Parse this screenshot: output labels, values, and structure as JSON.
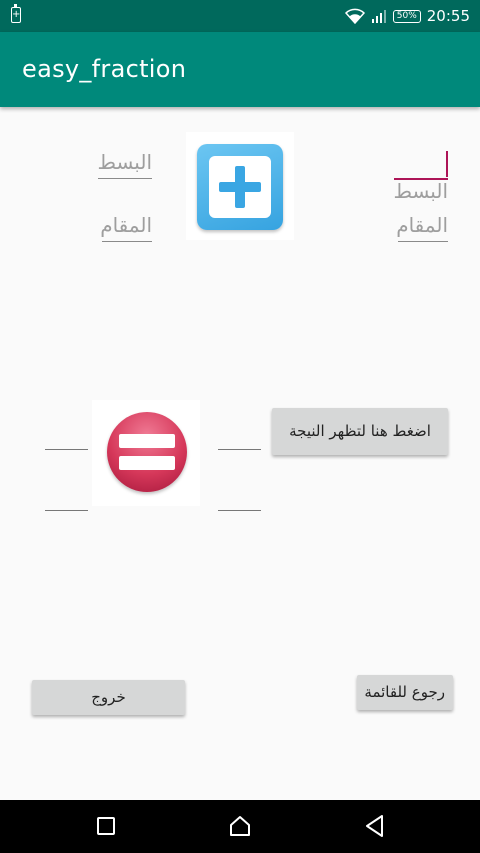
{
  "status_bar": {
    "battery_percent": "50%",
    "time": "20:55"
  },
  "app_bar": {
    "title": "easy_fraction"
  },
  "first_fraction": {
    "numerator_placeholder": "البسط",
    "denominator_placeholder": "المقام"
  },
  "second_fraction": {
    "numerator_placeholder": "البسط",
    "denominator_placeholder": "المقام"
  },
  "buttons": {
    "show_result": "اضغط هنا لتظهر النيجة",
    "exit": "خروج",
    "back_to_menu": "رجوع للقائمة"
  },
  "icons": {
    "operator": "plus-icon",
    "equals": "equals-icon"
  },
  "colors": {
    "status_bar": "#00695c",
    "app_bar": "#00897b",
    "accent": "#ad1457"
  }
}
